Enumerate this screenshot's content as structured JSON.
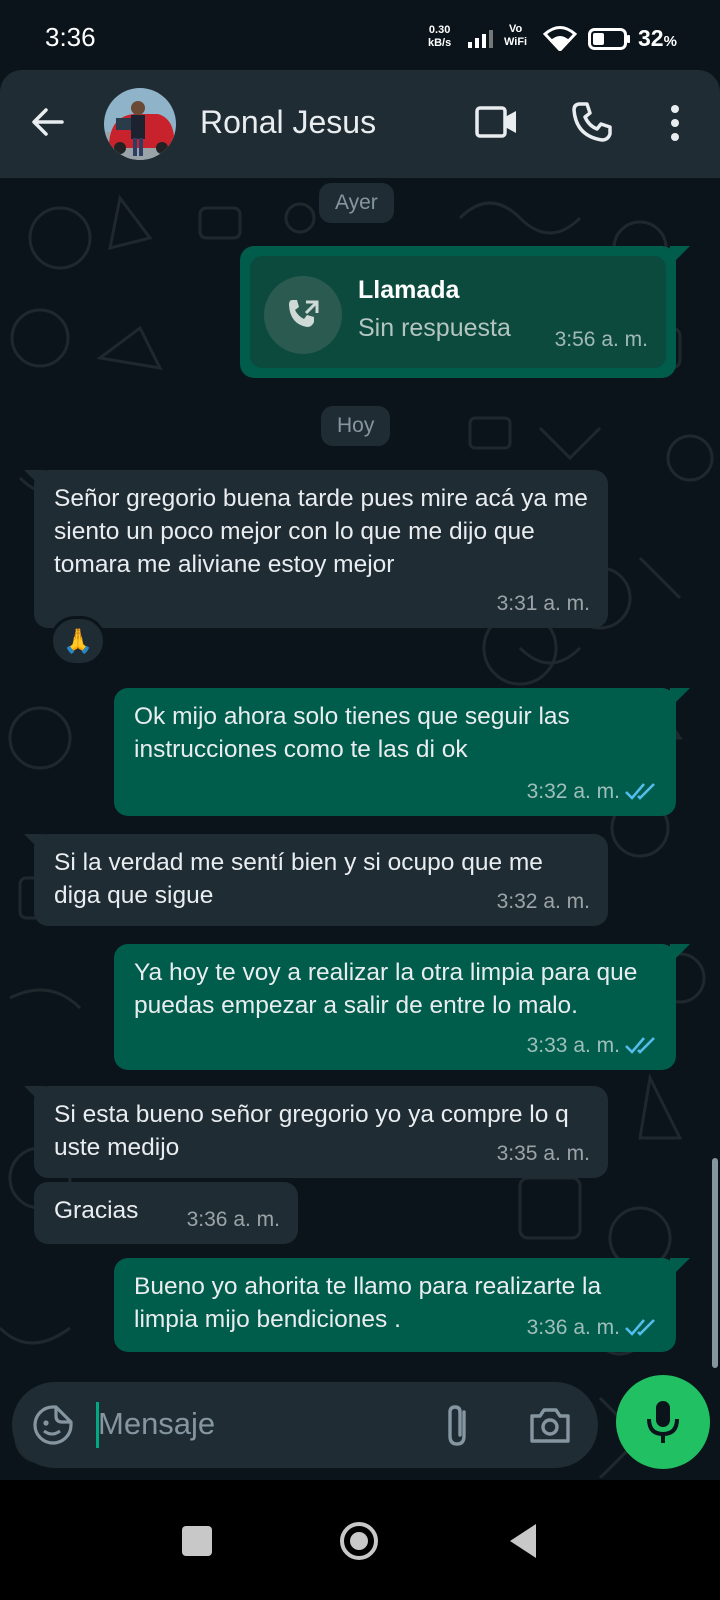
{
  "status_bar": {
    "time": "3:36",
    "net_speed_value": "0.30",
    "net_speed_unit": "kB/s",
    "volte_top": "Vo",
    "volte_bottom": "WiFi",
    "battery_pct": "32",
    "battery_unit": "%"
  },
  "header": {
    "contact_name": "Ronal Jesus",
    "icons": [
      "back-arrow-icon",
      "avatar",
      "video-call-icon",
      "phone-icon",
      "more-vert-icon"
    ]
  },
  "chat": {
    "day_yesterday": "Ayer",
    "day_today": "Hoy",
    "call": {
      "title": "Llamada",
      "subtitle": "Sin respuesta",
      "time": "3:56 a. m."
    },
    "messages": [
      {
        "dir": "in",
        "text": "Señor gregorio buena tarde pues mire acá ya me siento un poco mejor  con lo que me dijo que tomara me aliviane estoy mejor",
        "time": "3:31 a. m.",
        "reaction": "🙏"
      },
      {
        "dir": "out",
        "text": "Ok mijo ahora solo tienes que seguir las instrucciones como te las di ok",
        "time": "3:32 a. m.",
        "status": "read"
      },
      {
        "dir": "in",
        "text": "Si la verdad me sentí bien y si ocupo que me diga que sigue",
        "time": "3:32 a. m."
      },
      {
        "dir": "out",
        "text": "Ya hoy te voy a realizar la otra limpia para que puedas empezar a salir de entre lo malo.",
        "time": "3:33 a. m.",
        "status": "read"
      },
      {
        "dir": "in",
        "text": "Si esta bueno señor gregorio yo ya compre lo q uste medijo",
        "time": "3:35 a. m."
      },
      {
        "dir": "in",
        "text": "Gracias",
        "time": "3:36 a. m."
      },
      {
        "dir": "out",
        "text": "Bueno yo ahorita te llamo para realizarte la limpia mijo bendiciones .",
        "time": "3:36 a. m.",
        "status": "read"
      }
    ]
  },
  "input": {
    "placeholder": "Mensaje"
  },
  "colors": {
    "background": "#0b141a",
    "bubble_in": "#1f2c34",
    "bubble_out": "#005c4b",
    "accent_green": "#21c063",
    "read_ticks": "#53bdeb"
  }
}
